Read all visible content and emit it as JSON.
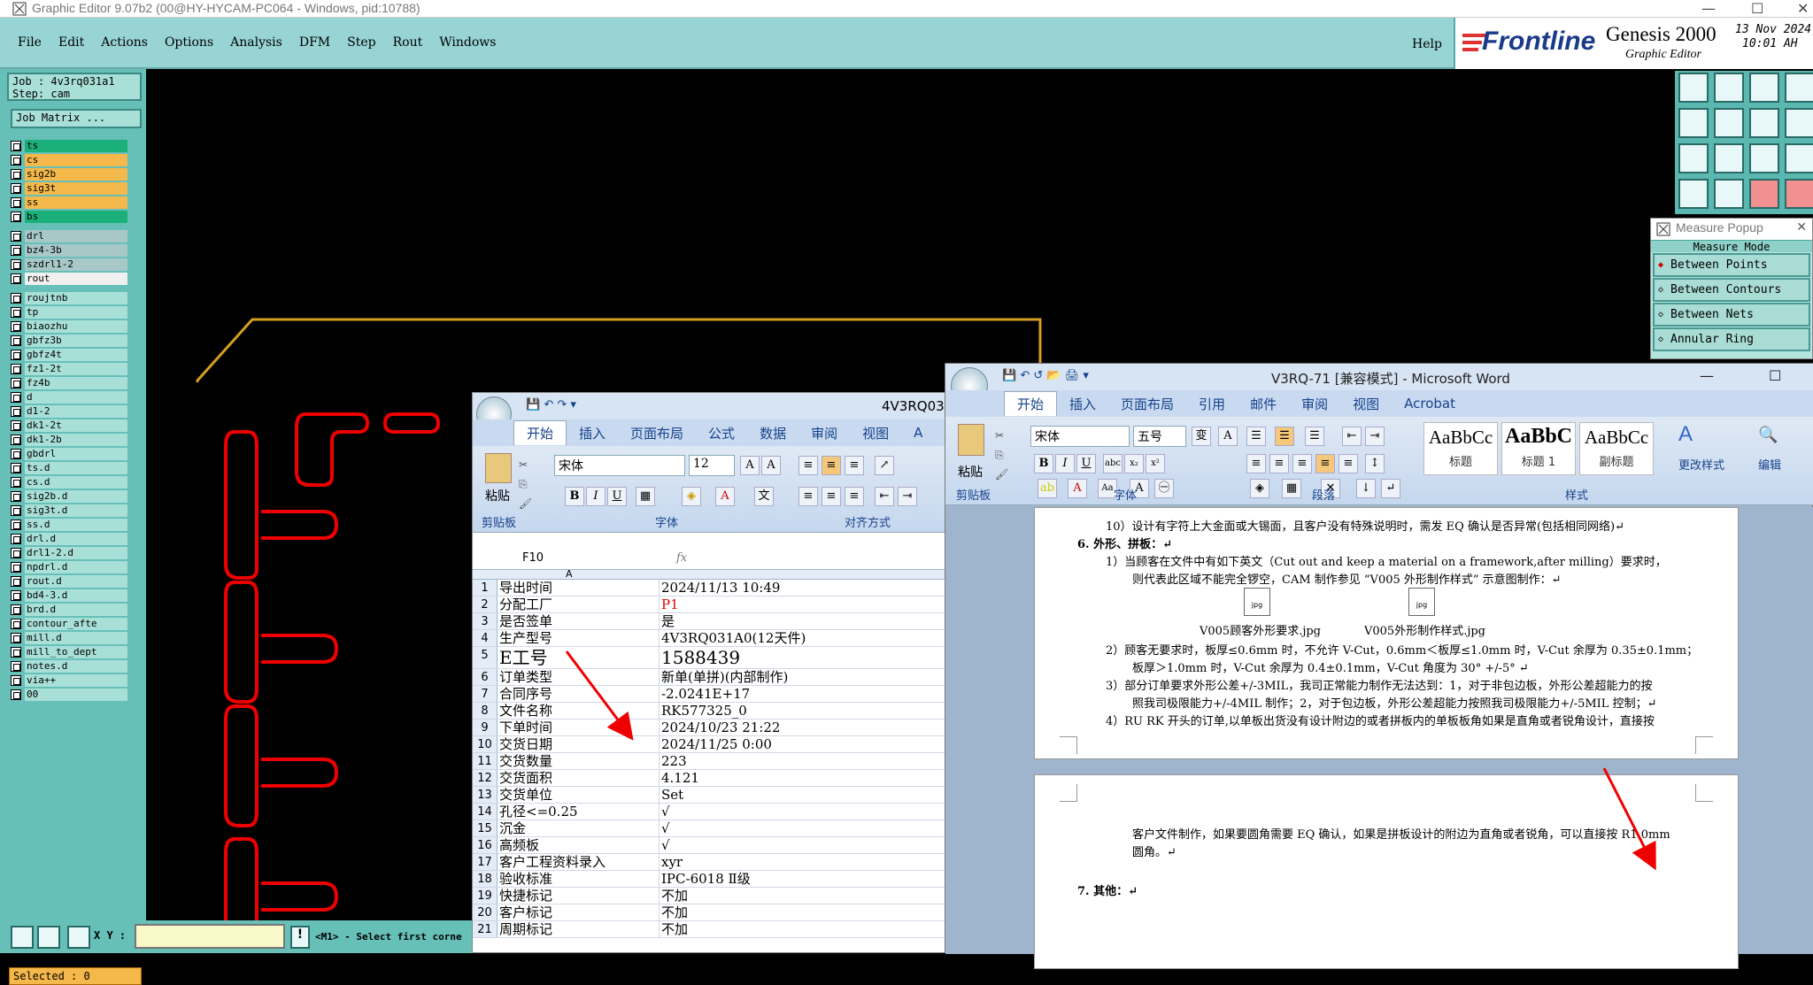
{
  "titlebar": {
    "title": "Graphic Editor 9.07b2 (00@HY-HYCAM-PC064 - Windows, pid:10788)"
  },
  "genesis_menu": {
    "items": [
      "File",
      "Edit",
      "Actions",
      "Options",
      "Analysis",
      "DFM",
      "Step",
      "Rout",
      "Windows"
    ],
    "help": "Help"
  },
  "logo": {
    "brand": "Frontline",
    "product": "Genesis 2000",
    "subtitle": "Graphic Editor",
    "date": "13 Nov 2024",
    "time": "10:01 AH"
  },
  "job": {
    "job": "Job : 4v3rq031a1",
    "step": "Step: cam",
    "matrix": "Job Matrix ..."
  },
  "layers": [
    {
      "name": "ts",
      "color": "#1bb07a"
    },
    {
      "name": "cs",
      "color": "#f5b84a"
    },
    {
      "name": "sig2b",
      "color": "#f5b84a"
    },
    {
      "name": "sig3t",
      "color": "#f5b84a"
    },
    {
      "name": "ss",
      "color": "#f5b84a"
    },
    {
      "name": "bs",
      "color": "#1bb07a"
    },
    {
      "name": "drl",
      "color": "#a8c8c8"
    },
    {
      "name": "bz4-3b",
      "color": "#a8c8c8"
    },
    {
      "name": "szdrl1-2",
      "color": "#a8c8c8"
    },
    {
      "name": "rout",
      "color": "#f0f0f0"
    },
    {
      "name": "roujtnb",
      "color": "#a8e0d8"
    },
    {
      "name": "tp",
      "color": "#a8e0d8"
    },
    {
      "name": "biaozhu",
      "color": "#a8e0d8"
    },
    {
      "name": "gbfz3b",
      "color": "#a8e0d8"
    },
    {
      "name": "gbfz4t",
      "color": "#a8e0d8"
    },
    {
      "name": "fz1-2t",
      "color": "#a8e0d8"
    },
    {
      "name": "fz4b",
      "color": "#a8e0d8"
    },
    {
      "name": "d",
      "color": "#a8e0d8"
    },
    {
      "name": "d1-2",
      "color": "#a8e0d8"
    },
    {
      "name": "dk1-2t",
      "color": "#a8e0d8"
    },
    {
      "name": "dk1-2b",
      "color": "#a8e0d8"
    },
    {
      "name": "gbdrl",
      "color": "#a8e0d8"
    },
    {
      "name": "ts.d",
      "color": "#a8e0d8"
    },
    {
      "name": "cs.d",
      "color": "#a8e0d8"
    },
    {
      "name": "sig2b.d",
      "color": "#a8e0d8"
    },
    {
      "name": "sig3t.d",
      "color": "#a8e0d8"
    },
    {
      "name": "ss.d",
      "color": "#a8e0d8"
    },
    {
      "name": "drl.d",
      "color": "#a8e0d8"
    },
    {
      "name": "drl1-2.d",
      "color": "#a8e0d8"
    },
    {
      "name": "npdrl.d",
      "color": "#a8e0d8"
    },
    {
      "name": "rout.d",
      "color": "#a8e0d8"
    },
    {
      "name": "bd4-3.d",
      "color": "#a8e0d8"
    },
    {
      "name": "brd.d",
      "color": "#a8e0d8"
    },
    {
      "name": "contour_afte",
      "color": "#a8e0d8"
    },
    {
      "name": "mill.d",
      "color": "#a8e0d8"
    },
    {
      "name": "mill_to_dept",
      "color": "#a8e0d8"
    },
    {
      "name": "notes.d",
      "color": "#a8e0d8"
    },
    {
      "name": "via++",
      "color": "#a8e0d8"
    },
    {
      "name": "00",
      "color": "#a8e0d8"
    }
  ],
  "status": {
    "selected": "Selected : 0",
    "xy_label": "X Y :",
    "prompt": "<M1> - Select first corne"
  },
  "measure": {
    "title": "Measure Popup",
    "mode": "Measure Mode",
    "options": [
      "Between Points",
      "Between Contours",
      "Between Nets",
      "Annular Ring"
    ]
  },
  "excel": {
    "title": "4V3RQ03",
    "tabs": [
      "开始",
      "插入",
      "页面布局",
      "公式",
      "数据",
      "审阅",
      "视图",
      "A"
    ],
    "font": "宋体",
    "size": "12",
    "paste": "粘贴",
    "groups": [
      "剪贴板",
      "字体",
      "对齐方式"
    ],
    "cell_ref": "F10",
    "fx": "fx",
    "col_a": "A",
    "rows": [
      {
        "n": "1",
        "a": "导出时间",
        "b": "2024/11/13 10:49"
      },
      {
        "n": "2",
        "a": "分配工厂",
        "b": "P1"
      },
      {
        "n": "3",
        "a": "是否签单",
        "b": "是"
      },
      {
        "n": "4",
        "a": "生产型号",
        "b": "4V3RQ031A0(12天件)"
      },
      {
        "n": "5",
        "a": "E工号",
        "b": "1588439"
      },
      {
        "n": "6",
        "a": "订单类型",
        "b": "新单(单拼)(内部制作)"
      },
      {
        "n": "7",
        "a": "合同序号",
        "b": "-2.0241E+17"
      },
      {
        "n": "8",
        "a": "文件名称",
        "b": "RK577325_0"
      },
      {
        "n": "9",
        "a": "下单时间",
        "b": "2024/10/23 21:22"
      },
      {
        "n": "10",
        "a": "交货日期",
        "b": "2024/11/25 0:00"
      },
      {
        "n": "11",
        "a": "交货数量",
        "b": "223"
      },
      {
        "n": "12",
        "a": "交货面积",
        "b": "4.121"
      },
      {
        "n": "13",
        "a": "交货单位",
        "b": "Set"
      },
      {
        "n": "14",
        "a": "孔径<=0.25",
        "b": "√"
      },
      {
        "n": "15",
        "a": "沉金",
        "b": "√"
      },
      {
        "n": "16",
        "a": "高频板",
        "b": "√"
      },
      {
        "n": "17",
        "a": "客户工程资料录入",
        "b": "xyr"
      },
      {
        "n": "18",
        "a": "验收标准",
        "b": "IPC-6018 Ⅱ级"
      },
      {
        "n": "19",
        "a": "快捷标记",
        "b": "不加"
      },
      {
        "n": "20",
        "a": "客户标记",
        "b": "不加"
      },
      {
        "n": "21",
        "a": "周期标记",
        "b": "不加"
      }
    ]
  },
  "word": {
    "title": "V3RQ-71 [兼容模式] - Microsoft Word",
    "tabs": [
      "开始",
      "插入",
      "页面布局",
      "引用",
      "邮件",
      "审阅",
      "视图",
      "Acrobat"
    ],
    "font": "宋体",
    "size": "五号",
    "paste": "粘贴",
    "styles": [
      {
        "sample": "AaBbCc",
        "name": "标题"
      },
      {
        "sample": "AaBbC",
        "name": "标题 1"
      },
      {
        "sample": "AaBbCc",
        "name": "副标题"
      }
    ],
    "change_styles": "更改样式",
    "edit": "编辑",
    "groups": [
      "剪贴板",
      "字体",
      "段落",
      "样式"
    ],
    "lines": [
      "10）设计有字符上大金面或大锡面，且客户没有特殊说明时，需发 EQ 确认是否异常(包括相同网络)↵",
      "6.   外形、拼板：↵",
      "1）当顾客在文件中有如下英文（Cut out and keep a material on a framework,after milling）要求时，",
      "则代表此区域不能完全锣空，CAM 制作参见 “V005 外形制作样式” 示意图制作：↵",
      "2）顾客无要求时，板厚≤0.6mm 时，不允许 V-Cut，0.6mm＜板厚≤1.0mm 时，V-Cut 余厚为 0.35±0.1mm；",
      "板厚＞1.0mm 时，V-Cut 余厚为 0.4±0.1mm，V-Cut 角度为 30° +/-5° ↵",
      "3）部分订单要求外形公差+/-3MIL，我司正常能力制作无法达到：1，对于非包边板，外形公差超能力的按",
      "照我司极限能力+/-4MIL 制作；2，对于包边板，外形公差超能力按照我司极限能力+/-5MIL 控制；↵",
      "4）RU RK 开头的订单,以单板出货没有设计附边的或者拼板内的单板板角如果是直角或者锐角设计，直接按"
    ],
    "file1": "V005顾客外形要求.jpg",
    "file2": "V005外形制作样式.jpg",
    "page2_lines": [
      "客户文件制作，如果要圆角需要 EQ 确认，如果是拼板设计的附边为直角或者锐角，可以直接按 R1.0mm",
      "圆角。↵",
      "7.   其他：↵"
    ]
  }
}
